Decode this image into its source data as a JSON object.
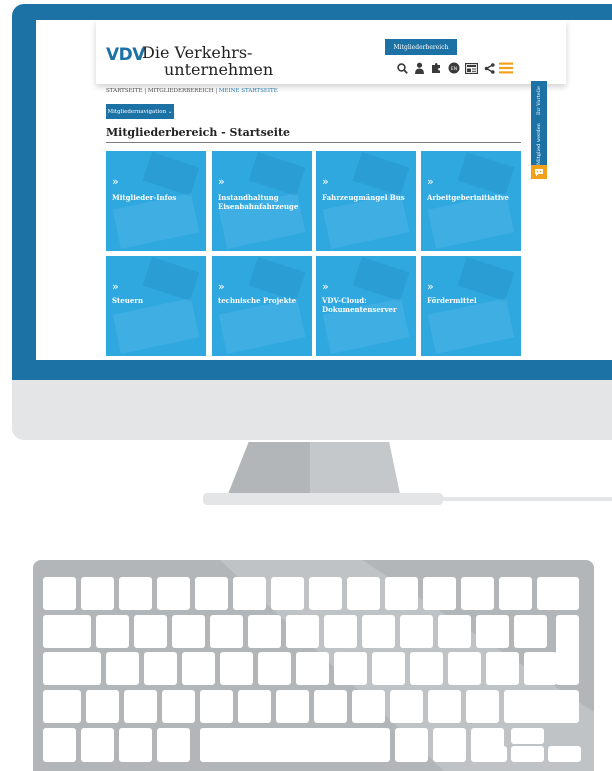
{
  "header": {
    "logo_abbrev": "VDV",
    "logo_line1": "Die Verkehrs-",
    "logo_line2": "unternehmen",
    "member_button": "Mitgliederbereich"
  },
  "side_tab": {
    "item1": "Ihr Vorteile",
    "item2": "Mitglied werden"
  },
  "breadcrumb": {
    "items": [
      "STARTSEITE",
      "MITGLIEDERBEREICH",
      "MEINE STARTSEITE"
    ],
    "separator": "|"
  },
  "nav_button": "Mitgliedernavigation ⌄",
  "page_title": "Mitgliederbereich - Startseite",
  "tiles": [
    {
      "chevron": "»",
      "label": "Mitglieder-Infos"
    },
    {
      "chevron": "»",
      "label": "Instandhaltung Eisenbahnfahrzeuge"
    },
    {
      "chevron": "»",
      "label": "Fahrzeugmängel Bus"
    },
    {
      "chevron": "»",
      "label": "Arbeitgeberinitiative"
    },
    {
      "chevron": "»",
      "label": "Steuern"
    },
    {
      "chevron": "»",
      "label": "technische Projekte"
    },
    {
      "chevron": "»",
      "label": "VDV-Cloud: Dokumentenserver"
    },
    {
      "chevron": "»",
      "label": "Fördermittel"
    }
  ],
  "icons": [
    "search-icon",
    "user-icon",
    "puzzle-icon",
    "language-icon",
    "newsletter-icon",
    "share-icon",
    "menu-icon"
  ],
  "colors": {
    "primary": "#1c71a5",
    "tile": "#2fa8e0",
    "accent": "#f3a11b",
    "frame": "#1c71a5",
    "chin": "#e3e5e7",
    "keyboard": "#b2b6b9"
  }
}
